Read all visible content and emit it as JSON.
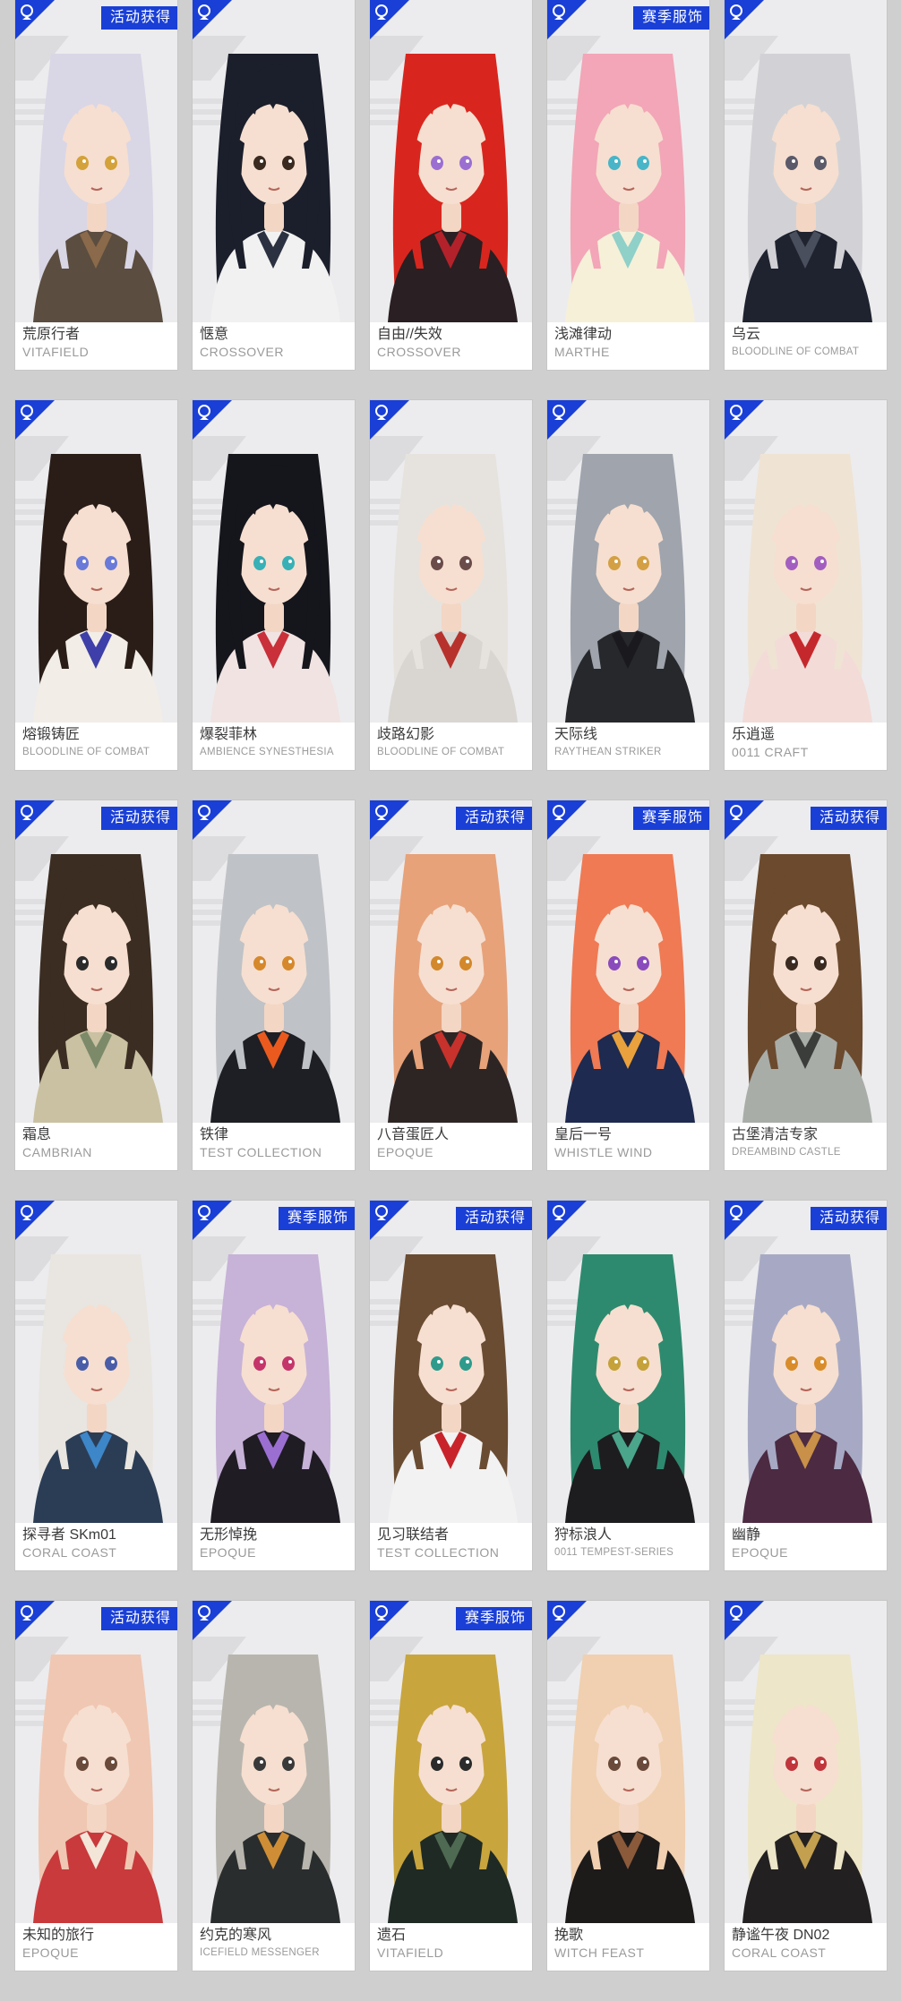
{
  "colors": {
    "background": "#cfcfcf",
    "card": "#ffffff",
    "badge": "#1a3fd6",
    "name_text": "#3a3a3a",
    "series_text": "#9a9a9a"
  },
  "icons": {
    "corner": "store-emblem-icon"
  },
  "cards": [
    {
      "name": "荒原行者",
      "series": "VITAFIELD",
      "badge": "活动获得",
      "hair": "#d9d6e6",
      "outfit": "#5b4d3f",
      "accent": "#8a6a4a",
      "eyes": "#d4a23a"
    },
    {
      "name": "惬意",
      "series": "CROSSOVER",
      "badge": "",
      "hair": "#1b1e2b",
      "outfit": "#f1f1f1",
      "accent": "#2b3140",
      "eyes": "#3a2a20"
    },
    {
      "name": "自由//失效",
      "series": "CROSSOVER",
      "badge": "",
      "hair": "#d8261e",
      "outfit": "#2a1f22",
      "accent": "#b3222a",
      "eyes": "#9b6fd1"
    },
    {
      "name": "浅滩律动",
      "series": "MARTHE",
      "badge": "赛季服饰",
      "hair": "#f2a6b7",
      "outfit": "#f6f0d9",
      "accent": "#8fd0c8",
      "eyes": "#48b5c8"
    },
    {
      "name": "乌云",
      "series": "BLOODLINE OF COMBAT",
      "badge": "",
      "hair": "#d2d2d6",
      "outfit": "#1f2330",
      "accent": "#4a4f5e",
      "eyes": "#5a5a6a"
    },
    {
      "name": "熔锻铸匠",
      "series": "BLOODLINE OF COMBAT",
      "badge": "",
      "hair": "#2a1d18",
      "outfit": "#f2ede6",
      "accent": "#3e3fa8",
      "eyes": "#6a7ad8"
    },
    {
      "name": "爆裂菲林",
      "series": "AMBIENCE SYNESTHESIA",
      "badge": "",
      "hair": "#15151c",
      "outfit": "#f0e3e2",
      "accent": "#c9303a",
      "eyes": "#38b0b6"
    },
    {
      "name": "歧路幻影",
      "series": "BLOODLINE OF COMBAT",
      "badge": "",
      "hair": "#e6e3df",
      "outfit": "#d9d6d2",
      "accent": "#b7322c",
      "eyes": "#6a4c4a"
    },
    {
      "name": "天际线",
      "series": "RAYTHEAN STRIKER",
      "badge": "",
      "hair": "#9fa4ad",
      "outfit": "#27282c",
      "accent": "#1a1a1e",
      "eyes": "#d3a044"
    },
    {
      "name": "乐逍遥",
      "series": "0011 CRAFT",
      "badge": "",
      "hair": "#efe3d4",
      "outfit": "#f3dbd8",
      "accent": "#c5282c",
      "eyes": "#a35fbf"
    },
    {
      "name": "霜息",
      "series": "CAMBRIAN",
      "badge": "活动获得",
      "hair": "#3b2d22",
      "outfit": "#c9c1a1",
      "accent": "#7c8a6a",
      "eyes": "#2b2b2b"
    },
    {
      "name": "铁律",
      "series": "TEST COLLECTION",
      "badge": "",
      "hair": "#bfc2c6",
      "outfit": "#1d1f24",
      "accent": "#ea5a1f",
      "eyes": "#d6882c"
    },
    {
      "name": "八音蛋匠人",
      "series": "EPOQUE",
      "badge": "活动获得",
      "hair": "#e7a27a",
      "outfit": "#2d2524",
      "accent": "#c8322c",
      "eyes": "#d3882c"
    },
    {
      "name": "皇后一号",
      "series": "WHISTLE WIND",
      "badge": "赛季服饰",
      "hair": "#ef7a54",
      "outfit": "#1e2a4f",
      "accent": "#e9a13d",
      "eyes": "#8a4bbd"
    },
    {
      "name": "古堡清洁专家",
      "series": "DREAMBIND CASTLE",
      "badge": "活动获得",
      "hair": "#6b4a2e",
      "outfit": "#a9ada8",
      "accent": "#3a3d3a",
      "eyes": "#3a2a20"
    },
    {
      "name": "探寻者 SKm01",
      "series": "CORAL COAST",
      "badge": "",
      "hair": "#e9e5e0",
      "outfit": "#2b3d55",
      "accent": "#3d86c8",
      "eyes": "#4a5ea8"
    },
    {
      "name": "无形悼挽",
      "series": "EPOQUE",
      "badge": "赛季服饰",
      "hair": "#c7b2d8",
      "outfit": "#1f1c24",
      "accent": "#9b6fd1",
      "eyes": "#c4356a"
    },
    {
      "name": "见习联结者",
      "series": "TEST COLLECTION",
      "badge": "活动获得",
      "hair": "#6a4c32",
      "outfit": "#f2f2f2",
      "accent": "#c8232a",
      "eyes": "#2f9b8c"
    },
    {
      "name": "狩标浪人",
      "series": "0011 TEMPEST-SERIES",
      "badge": "",
      "hair": "#2e8a6e",
      "outfit": "#1d1d20",
      "accent": "#4aa58a",
      "eyes": "#c5a23a"
    },
    {
      "name": "幽静",
      "series": "EPOQUE",
      "badge": "活动获得",
      "hair": "#a7a9c4",
      "outfit": "#4b2a42",
      "accent": "#c89048",
      "eyes": "#d98c2a"
    },
    {
      "name": "未知的旅行",
      "series": "EPOQUE",
      "badge": "活动获得",
      "hair": "#f0c7b2",
      "outfit": "#c83a3c",
      "accent": "#f3e6d8",
      "eyes": "#6a4a3a"
    },
    {
      "name": "约克的寒风",
      "series": "ICEFIELD MESSENGER",
      "badge": "",
      "hair": "#b8b5ae",
      "outfit": "#2a2d2e",
      "accent": "#cf8e35",
      "eyes": "#3a3a3a"
    },
    {
      "name": "遗石",
      "series": "VITAFIELD",
      "badge": "赛季服饰",
      "hair": "#c9a53e",
      "outfit": "#1f2a24",
      "accent": "#4f6a52",
      "eyes": "#2b2b2b"
    },
    {
      "name": "挽歌",
      "series": "WITCH FEAST",
      "badge": "",
      "hair": "#f0d0b0",
      "outfit": "#1d1a1a",
      "accent": "#8a5a3a",
      "eyes": "#6a4a3a"
    },
    {
      "name": "静谧午夜 DN02",
      "series": "CORAL COAST",
      "badge": "",
      "hair": "#ede6c8",
      "outfit": "#232021",
      "accent": "#c2a050",
      "eyes": "#c0363c"
    }
  ]
}
